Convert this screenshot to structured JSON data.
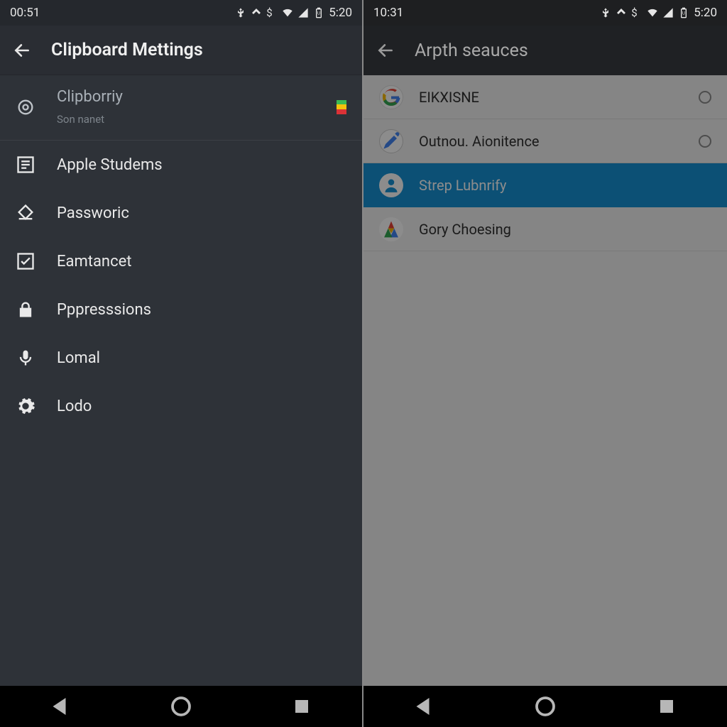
{
  "left": {
    "status": {
      "clock_left": "00:51",
      "clock_right": "5:20"
    },
    "appbar": {
      "title": "Clipboard Mettings"
    },
    "header": {
      "title": "Clipborriy",
      "subtitle": "Son nanet",
      "flag_colors": [
        "#3cba54",
        "#f4c20d",
        "#db3236"
      ]
    },
    "items": [
      {
        "icon": "list-icon",
        "label": "Apple Studems"
      },
      {
        "icon": "diamond-icon",
        "label": "Passworic"
      },
      {
        "icon": "checkbox-icon",
        "label": "Eamtancet"
      },
      {
        "icon": "lock-icon",
        "label": "Pppresssions"
      },
      {
        "icon": "mic-icon",
        "label": "Lomal"
      },
      {
        "icon": "gear-icon",
        "label": "Lodo"
      }
    ]
  },
  "right": {
    "status": {
      "clock_left": "10:31",
      "clock_right": "5:20"
    },
    "appbar": {
      "title": "Arpth seauces"
    },
    "items": [
      {
        "icon": "google-g-icon",
        "label": "EIKXISNE",
        "selected": false,
        "has_radio": true
      },
      {
        "icon": "pen-circle-icon",
        "label": "Outnou. Aionitence",
        "selected": false,
        "has_radio": true
      },
      {
        "icon": "person-circle-icon",
        "label": "Strep Lubnrify",
        "selected": true,
        "has_radio": false
      },
      {
        "icon": "google-a-icon",
        "label": "Gory Choesing",
        "selected": false,
        "has_radio": false
      }
    ]
  },
  "icons": {
    "status_indicators": [
      "usb-icon",
      "cast-icon",
      "dollar-icon",
      "wifi-icon",
      "cell-signal-icon",
      "battery-icon"
    ]
  }
}
